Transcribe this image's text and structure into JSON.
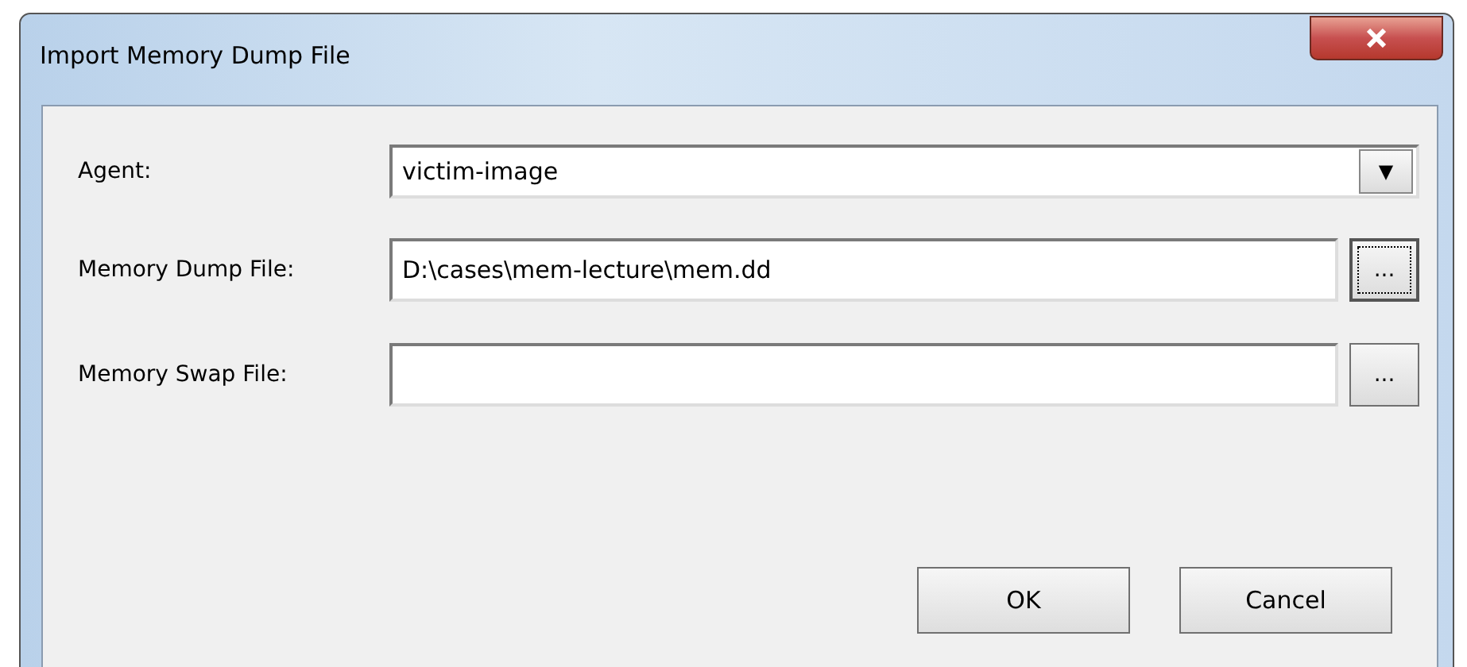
{
  "window": {
    "title": "Import Memory Dump File"
  },
  "fields": [
    {
      "kind": "dropdown",
      "label": "Agent:",
      "value": "victim-image",
      "button": "▼"
    },
    {
      "kind": "file",
      "label": "Memory Dump File:",
      "value": "D:\\cases\\mem-lecture\\mem.dd",
      "button": "...",
      "focused": true
    },
    {
      "kind": "file",
      "label": "Memory Swap File:",
      "button": "...",
      "focused": false
    }
  ],
  "buttons": [
    "OK",
    "Cancel"
  ]
}
